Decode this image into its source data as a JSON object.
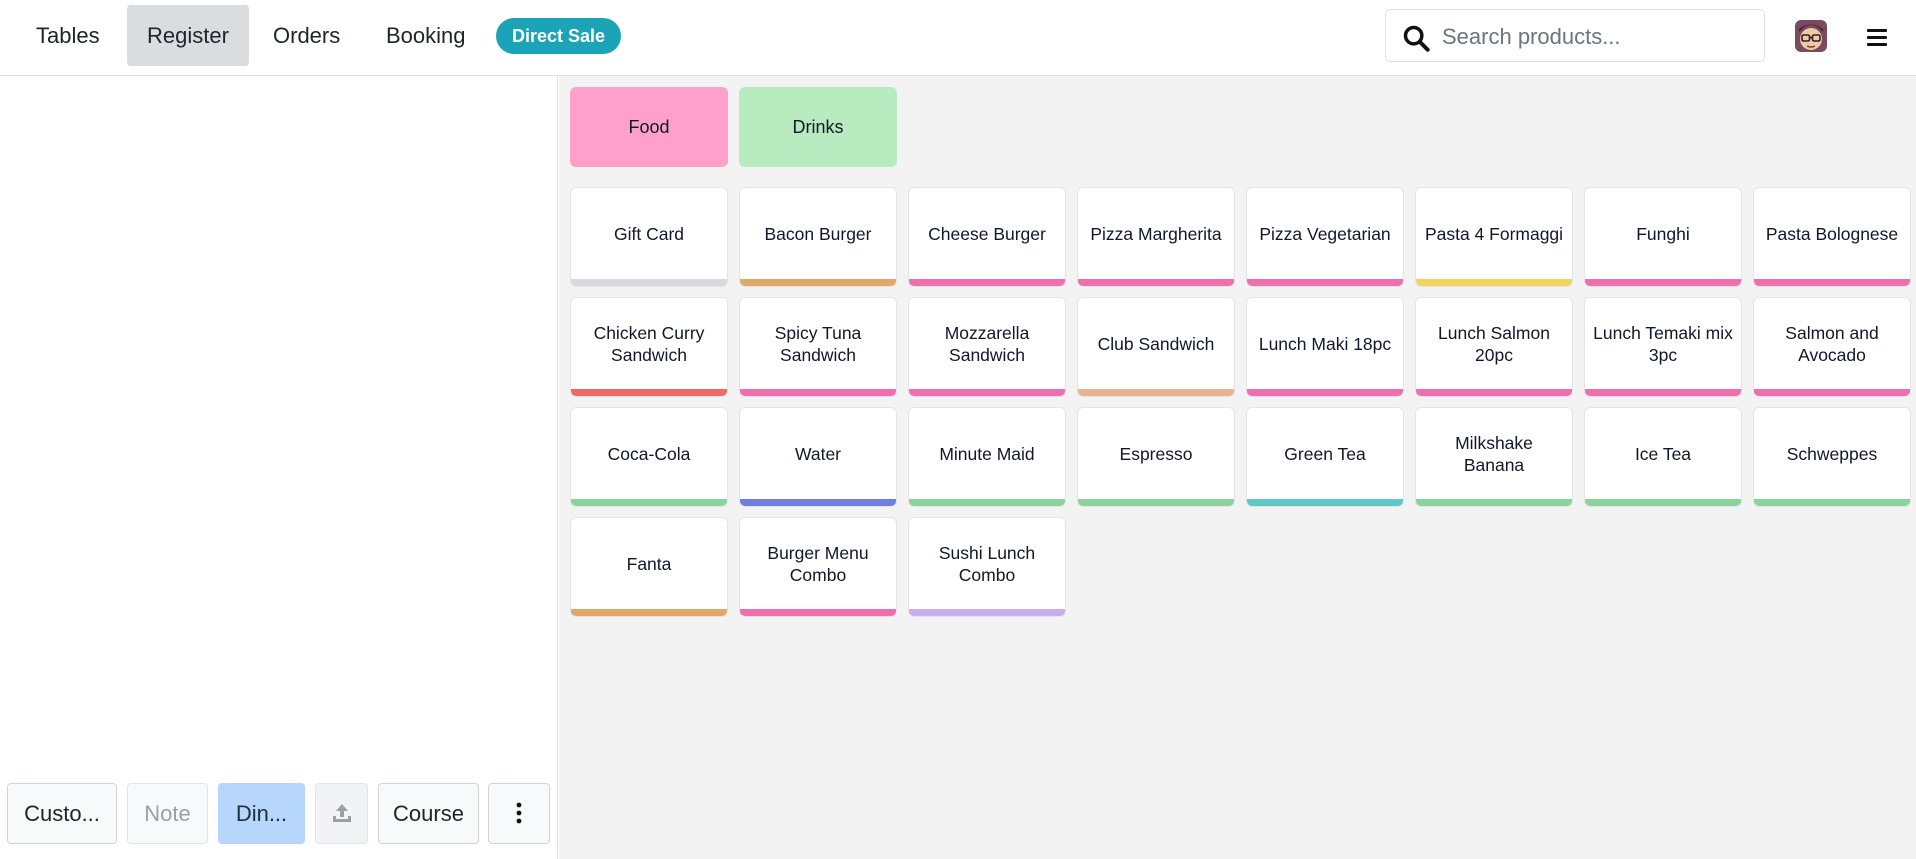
{
  "nav": {
    "tabs": [
      {
        "label": "Tables"
      },
      {
        "label": "Register"
      },
      {
        "label": "Orders"
      },
      {
        "label": "Booking"
      }
    ],
    "direct_sale_label": "Direct Sale"
  },
  "search": {
    "placeholder": "Search products..."
  },
  "controls": {
    "customer_label": "Custo...",
    "note_label": "Note",
    "dine_label": "Din...",
    "course_label": "Course"
  },
  "categories": [
    {
      "label": "Food",
      "color": "#ffa0cb"
    },
    {
      "label": "Drinks",
      "color": "#b8ecc0"
    }
  ],
  "products": [
    {
      "name": "Gift Card",
      "color": "#d8d8de"
    },
    {
      "name": "Bacon Burger",
      "color": "#e2a86a"
    },
    {
      "name": "Cheese Burger",
      "color": "#ef6eae"
    },
    {
      "name": "Pizza Margherita",
      "color": "#ef6eae"
    },
    {
      "name": "Pizza Vegetarian",
      "color": "#ef6eae"
    },
    {
      "name": "Pasta 4 Formaggi",
      "color": "#f4d35e"
    },
    {
      "name": "Funghi",
      "color": "#ef6eae"
    },
    {
      "name": "Pasta Bolognese",
      "color": "#ef6eae"
    },
    {
      "name": "Chicken Curry Sandwich",
      "color": "#ef6a62"
    },
    {
      "name": "Spicy Tuna Sandwich",
      "color": "#ef6eae"
    },
    {
      "name": "Mozzarella Sandwich",
      "color": "#ef6eae"
    },
    {
      "name": "Club Sandwich",
      "color": "#e9b28e"
    },
    {
      "name": "Lunch Maki 18pc",
      "color": "#ef6eae"
    },
    {
      "name": "Lunch Salmon 20pc",
      "color": "#ef6eae"
    },
    {
      "name": "Lunch Temaki mix 3pc",
      "color": "#ef6eae"
    },
    {
      "name": "Salmon and Avocado",
      "color": "#ef6eae"
    },
    {
      "name": "Coca-Cola",
      "color": "#8bd39b"
    },
    {
      "name": "Water",
      "color": "#6f7fe0"
    },
    {
      "name": "Minute Maid",
      "color": "#8bd39b"
    },
    {
      "name": "Espresso",
      "color": "#8bd39b"
    },
    {
      "name": "Green Tea",
      "color": "#5ec8c4"
    },
    {
      "name": "Milkshake Banana",
      "color": "#8bd39b"
    },
    {
      "name": "Ice Tea",
      "color": "#8bd39b"
    },
    {
      "name": "Schweppes",
      "color": "#8bd39b"
    },
    {
      "name": "Fanta",
      "color": "#e2a86a"
    },
    {
      "name": "Burger Menu Combo",
      "color": "#ef6eae"
    },
    {
      "name": "Sushi Lunch Combo",
      "color": "#c6aef0"
    }
  ],
  "colors": {
    "accent": "#1ba3b8",
    "active_tab": "#dadce0",
    "info_button": "#b7d6fb",
    "product_area_bg": "#f3f3f3"
  },
  "icons": {
    "search": "search-icon",
    "avatar": "user-avatar",
    "menu": "hamburger-menu-icon",
    "upload": "upload-icon",
    "more": "vertical-dots-icon"
  }
}
